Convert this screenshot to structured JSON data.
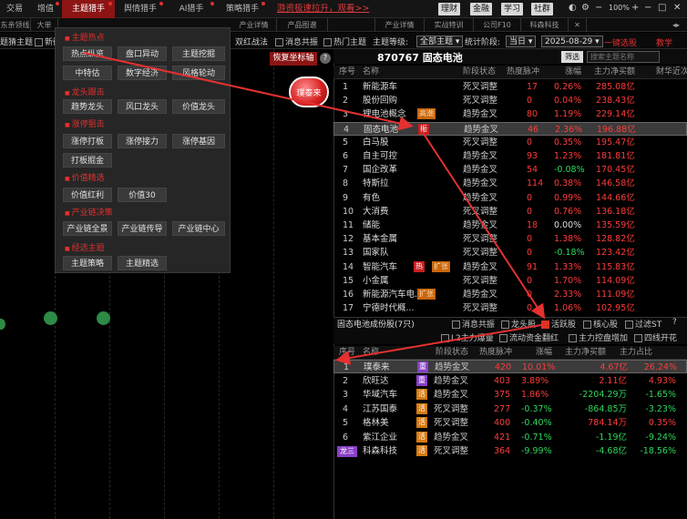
{
  "topbar": {
    "items": [
      "交易",
      "增值",
      "主题猎手",
      "舆情猎手",
      "AI猎手",
      "策略猎手"
    ],
    "promo": "游资极速拉升，观看>>",
    "buttons": [
      "理财",
      "金融",
      "学习",
      "社群"
    ],
    "zoom": "100%"
  },
  "row2_tabs": [
    "东亲领线",
    "大单",
    "",
    "",
    "",
    "",
    "产业详情",
    "产品图谱",
    "",
    "产业详情",
    "实战特训",
    "公司F10",
    "科森科技"
  ],
  "row3": {
    "left_label": "题猜主题",
    "left_check": "新衡",
    "double_red": "双红战法",
    "msg_co": "消息共振",
    "hot_topic": "热门主题",
    "topic_level_label": "主题等级:",
    "topic_level": "全部主题",
    "stat_label": "统计阶段:",
    "stat_value": "当日",
    "date": "2025-08-29",
    "yijian": "一键选股",
    "jiaoxue": "教学"
  },
  "restore_btn": "恢复坐标轴",
  "help_icon": "?",
  "ball_label": "璞泰来",
  "menu": {
    "sections": [
      {
        "title": "主题热点",
        "items": [
          "热点纵览",
          "盘口异动",
          "主题挖掘",
          "中特估",
          "数字经济",
          "风格轮动"
        ]
      },
      {
        "title": "龙头跟击",
        "items": [
          "趋势龙头",
          "风口龙头",
          "价值龙头"
        ]
      },
      {
        "title": "涨停狙击",
        "items": [
          "涨停打板",
          "涨停接力",
          "涨停基因",
          "打板掘金"
        ]
      },
      {
        "title": "价值精选",
        "items": [
          "价值红利",
          "价值30"
        ]
      },
      {
        "title": "产业链决策",
        "items": [
          "产业链全景",
          "产业链传导",
          "产业链中心"
        ]
      },
      {
        "title": "经选主题",
        "items": [
          "主题策略",
          "主题精选"
        ]
      }
    ]
  },
  "right": {
    "code_title": "870767 固态电池",
    "filter_btn": "筛选",
    "search_placeholder": "搜索主题名称",
    "headers": [
      "序号",
      "名称",
      "阶段状态",
      "热度脉冲",
      "涨幅",
      "主力净买额",
      "财华近次"
    ],
    "rows": [
      {
        "no": "1",
        "name": "新能源车",
        "tag": "",
        "tag_color": "",
        "status": "死叉调整",
        "heat": "17",
        "chg": "0.26%",
        "amt": "285.08亿"
      },
      {
        "no": "2",
        "name": "股份回购",
        "tag": "",
        "tag_color": "",
        "status": "死叉调整",
        "heat": "0",
        "chg": "0.04%",
        "amt": "238.43亿"
      },
      {
        "no": "3",
        "name": "锂电池概念",
        "tag": "高潮",
        "tag_color": "orange",
        "status": "趋势金叉",
        "heat": "80",
        "chg": "1.19%",
        "amt": "229.14亿"
      },
      {
        "no": "4",
        "name": "固态电池",
        "tag": "振",
        "tag_color": "red",
        "status": "趋势金叉",
        "heat": "46",
        "chg": "2.36%",
        "amt": "196.88亿"
      },
      {
        "no": "5",
        "name": "白马股",
        "tag": "",
        "tag_color": "",
        "status": "死叉调整",
        "heat": "0",
        "chg": "0.35%",
        "amt": "195.47亿"
      },
      {
        "no": "6",
        "name": "自主可控",
        "tag": "",
        "tag_color": "",
        "status": "趋势金叉",
        "heat": "93",
        "chg": "1.23%",
        "amt": "181.81亿"
      },
      {
        "no": "7",
        "name": "国企改革",
        "tag": "",
        "tag_color": "",
        "status": "趋势金叉",
        "heat": "54",
        "chg": "-0.08%",
        "amt": "170.45亿"
      },
      {
        "no": "8",
        "name": "特斯拉",
        "tag": "",
        "tag_color": "",
        "status": "趋势金叉",
        "heat": "114",
        "chg": "0.38%",
        "amt": "146.58亿"
      },
      {
        "no": "9",
        "name": "有色",
        "tag": "",
        "tag_color": "",
        "status": "趋势金叉",
        "heat": "0",
        "chg": "0.99%",
        "amt": "144.66亿"
      },
      {
        "no": "10",
        "name": "大消费",
        "tag": "",
        "tag_color": "",
        "status": "死叉调整",
        "heat": "0",
        "chg": "0.76%",
        "amt": "136.18亿"
      },
      {
        "no": "11",
        "name": "储能",
        "tag": "",
        "tag_color": "",
        "status": "趋势金叉",
        "heat": "18",
        "chg": "0.00%",
        "amt": "135.59亿"
      },
      {
        "no": "12",
        "name": "基本金属",
        "tag": "",
        "tag_color": "",
        "status": "死叉调整",
        "heat": "0",
        "chg": "1.38%",
        "amt": "128.82亿"
      },
      {
        "no": "13",
        "name": "国家队",
        "tag": "",
        "tag_color": "",
        "status": "死叉调整",
        "heat": "0",
        "chg": "-0.18%",
        "amt": "123.42亿"
      },
      {
        "no": "14",
        "name": "智能汽车",
        "tag": "热",
        "tag2": "扩张",
        "tag_color": "red",
        "status": "趋势金叉",
        "heat": "91",
        "chg": "1.33%",
        "amt": "115.83亿"
      },
      {
        "no": "15",
        "name": "小金属",
        "tag": "",
        "tag_color": "",
        "status": "死叉调整",
        "heat": "0",
        "chg": "1.70%",
        "amt": "114.09亿"
      },
      {
        "no": "16",
        "name": "新能源汽车电...",
        "tag": "扩张",
        "tag_color": "orange",
        "status": "趋势金叉",
        "heat": "0",
        "chg": "2.33%",
        "amt": "111.09亿"
      },
      {
        "no": "17",
        "name": "宁德时代概...",
        "tag": "",
        "tag_color": "",
        "status": "死叉调整",
        "heat": "0",
        "chg": "1.06%",
        "amt": "102.95亿"
      }
    ],
    "bottom": {
      "title": "固态电池成份股(7只)",
      "opts1": [
        "消息共振",
        "龙头股",
        "活跃股",
        "核心股",
        "过滤ST"
      ],
      "opts1_checked": [
        false,
        false,
        true,
        false,
        false
      ],
      "opts2": [
        "L2主力爆量",
        "流动资金翻红",
        "主力控盘增加",
        "四线开花"
      ],
      "headers": [
        "序号",
        "名称",
        "阶段状态",
        "热度脉冲",
        "涨幅",
        "主力净买额",
        "主力占比"
      ],
      "rows": [
        {
          "no": "1",
          "name": "璞泰来",
          "badge": "重",
          "badge_color": "p",
          "status": "趋势金叉",
          "heat": "420",
          "chg": "10.01%",
          "amt": "4.67亿",
          "ratio": "26.24%"
        },
        {
          "no": "2",
          "name": "欣旺达",
          "badge": "重",
          "badge_color": "p",
          "status": "趋势金叉",
          "heat": "403",
          "chg": "3.89%",
          "amt": "2.11亿",
          "ratio": "4.93%"
        },
        {
          "no": "3",
          "name": "华域汽车",
          "badge": "活",
          "badge_color": "o",
          "status": "趋势金叉",
          "heat": "375",
          "chg": "1.86%",
          "amt": "-2204.29万",
          "ratio": "-1.65%"
        },
        {
          "no": "4",
          "name": "江苏国泰",
          "badge": "活",
          "badge_color": "o",
          "status": "死叉调整",
          "heat": "277",
          "chg": "-0.37%",
          "amt": "-864.85万",
          "ratio": "-3.23%"
        },
        {
          "no": "5",
          "name": "格林美",
          "badge": "活",
          "badge_color": "o",
          "status": "死叉调整",
          "heat": "400",
          "chg": "-0.40%",
          "amt": "784.14万",
          "ratio": "0.35%"
        },
        {
          "no": "6",
          "name": "紫江企业",
          "badge": "活",
          "badge_color": "o",
          "status": "趋势金叉",
          "heat": "421",
          "chg": "-0.71%",
          "amt": "-1.19亿",
          "ratio": "-9.24%"
        },
        {
          "no": "",
          "name": "科森科技",
          "badge": "活",
          "badge_color": "o",
          "prefix": "龙三",
          "status": "死叉调整",
          "heat": "364",
          "chg": "-9.99%",
          "amt": "-4.68亿",
          "ratio": "-18.56%"
        }
      ]
    }
  }
}
